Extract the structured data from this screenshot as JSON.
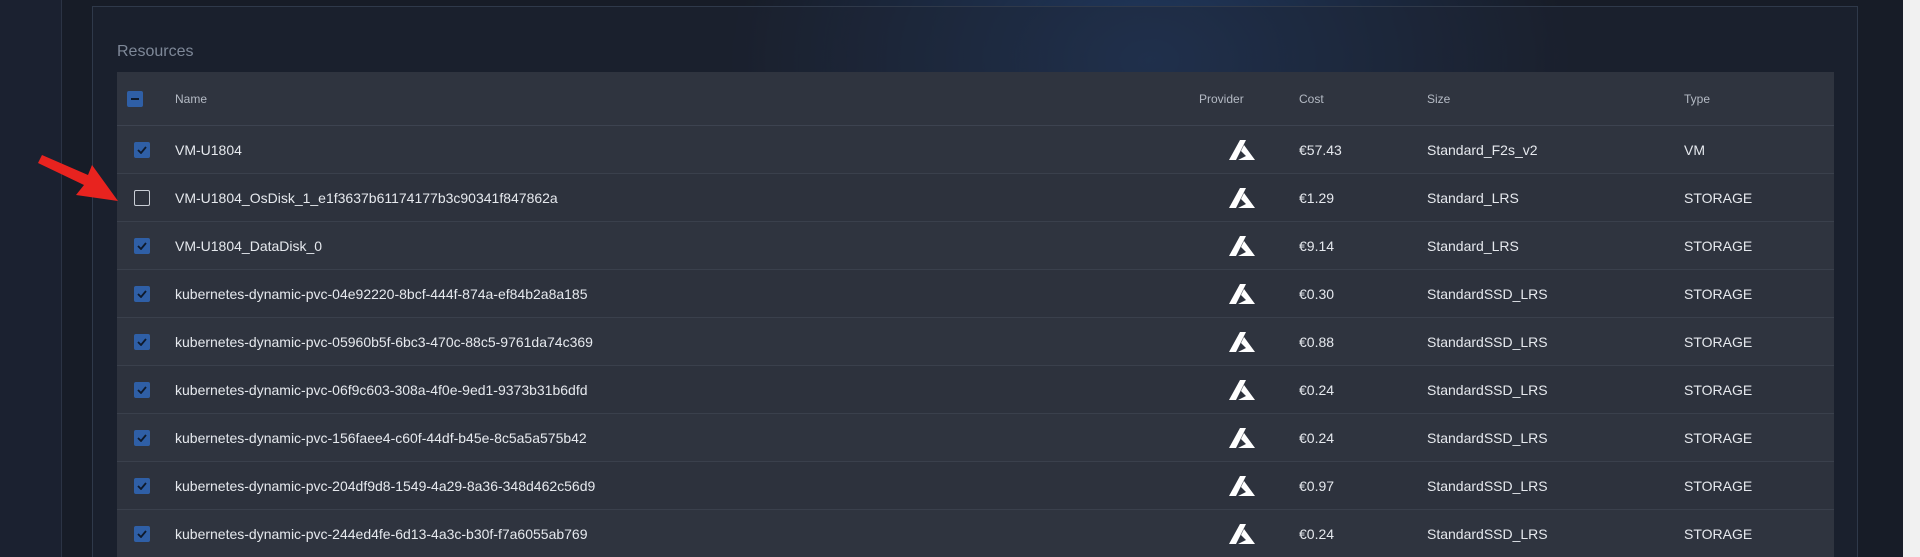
{
  "section_title": "Resources",
  "columns": {
    "name": "Name",
    "provider": "Provider",
    "cost": "Cost",
    "size": "Size",
    "type": "Type"
  },
  "select_all_state": "indeterminate",
  "rows": [
    {
      "name": "VM-U1804",
      "provider_icon": "azure-icon",
      "cost": "€57.43",
      "size": "Standard_F2s_v2",
      "type": "VM",
      "checked": true
    },
    {
      "name": "VM-U1804_OsDisk_1_e1f3637b61174177b3c90341f847862a",
      "provider_icon": "azure-icon",
      "cost": "€1.29",
      "size": "Standard_LRS",
      "type": "STORAGE",
      "checked": false
    },
    {
      "name": "VM-U1804_DataDisk_0",
      "provider_icon": "azure-icon",
      "cost": "€9.14",
      "size": "Standard_LRS",
      "type": "STORAGE",
      "checked": true
    },
    {
      "name": "kubernetes-dynamic-pvc-04e92220-8bcf-444f-874a-ef84b2a8a185",
      "provider_icon": "azure-icon",
      "cost": "€0.30",
      "size": "StandardSSD_LRS",
      "type": "STORAGE",
      "checked": true
    },
    {
      "name": "kubernetes-dynamic-pvc-05960b5f-6bc3-470c-88c5-9761da74c369",
      "provider_icon": "azure-icon",
      "cost": "€0.88",
      "size": "StandardSSD_LRS",
      "type": "STORAGE",
      "checked": true
    },
    {
      "name": "kubernetes-dynamic-pvc-06f9c603-308a-4f0e-9ed1-9373b31b6dfd",
      "provider_icon": "azure-icon",
      "cost": "€0.24",
      "size": "StandardSSD_LRS",
      "type": "STORAGE",
      "checked": true
    },
    {
      "name": "kubernetes-dynamic-pvc-156faee4-c60f-44df-b45e-8c5a5a575b42",
      "provider_icon": "azure-icon",
      "cost": "€0.24",
      "size": "StandardSSD_LRS",
      "type": "STORAGE",
      "checked": true
    },
    {
      "name": "kubernetes-dynamic-pvc-204df9d8-1549-4a29-8a36-348d462c56d9",
      "provider_icon": "azure-icon",
      "cost": "€0.97",
      "size": "StandardSSD_LRS",
      "type": "STORAGE",
      "checked": true
    },
    {
      "name": "kubernetes-dynamic-pvc-244ed4fe-6d13-4a3c-b30f-f7a6055ab769",
      "provider_icon": "azure-icon",
      "cost": "€0.24",
      "size": "StandardSSD_LRS",
      "type": "STORAGE",
      "checked": true
    }
  ],
  "colors": {
    "accent": "#2f5fa6",
    "annotation_arrow": "#e8231f"
  }
}
